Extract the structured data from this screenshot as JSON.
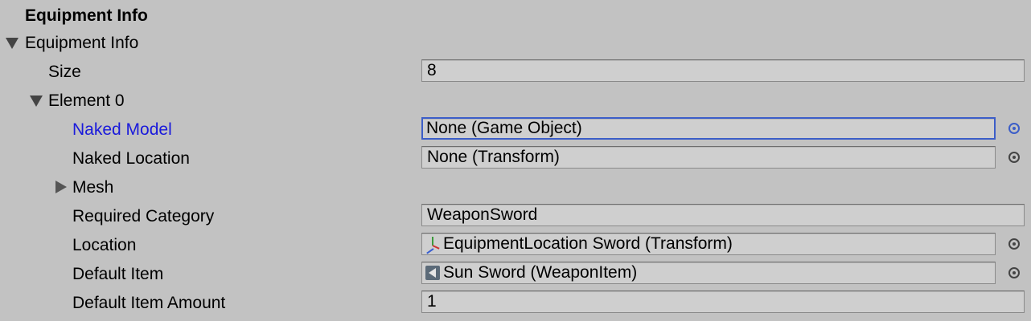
{
  "header": {
    "title": "Equipment Info"
  },
  "foldout": {
    "label": "Equipment Info"
  },
  "size": {
    "label": "Size",
    "value": "8"
  },
  "element": {
    "label": "Element 0"
  },
  "fields": {
    "naked_model": {
      "label": "Naked Model",
      "value": "None (Game Object)"
    },
    "naked_location": {
      "label": "Naked Location",
      "value": "None (Transform)"
    },
    "mesh": {
      "label": "Mesh"
    },
    "required_category": {
      "label": "Required Category",
      "value": "WeaponSword"
    },
    "location": {
      "label": "Location",
      "value": "EquipmentLocation Sword (Transform)",
      "icon": "transform-gizmo-icon"
    },
    "default_item": {
      "label": "Default Item",
      "value": "Sun Sword (WeaponItem)",
      "icon": "scriptable-object-icon"
    },
    "default_item_amount": {
      "label": "Default Item Amount",
      "value": "1"
    }
  },
  "colors": {
    "background": "#c2c2c2",
    "field": "#cfcfcf",
    "focus_accent": "#3c5ec8",
    "focused_label": "#1a1adb"
  }
}
